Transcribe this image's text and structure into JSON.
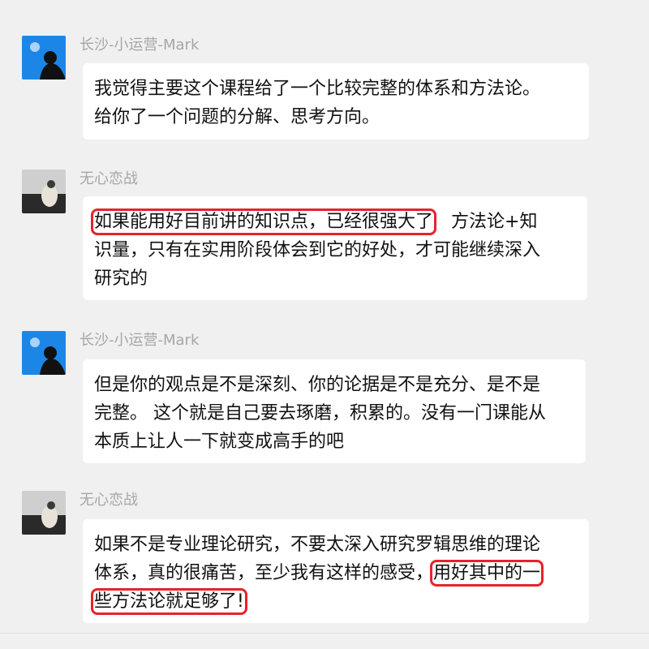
{
  "chat": {
    "messages": [
      {
        "sender": "长沙-小运营-Mark",
        "avatar_icon": "blue-silhouette-avatar-icon",
        "lines": [
          "我觉得主要这个课程给了一个比较完整的体系和方法论。",
          "给你了一个问题的分解、思考方向。"
        ]
      },
      {
        "sender": "无心恋战",
        "avatar_icon": "dark-photo-avatar-icon",
        "highlight": "如果能用好目前讲的知识点，已经很强大了",
        "line1_rest": "方法论+知",
        "lines": [
          "识量，只有在实用阶段体会到它的好处，才可能继续深入",
          "研究的"
        ]
      },
      {
        "sender": "长沙-小运营-Mark",
        "avatar_icon": "blue-silhouette-avatar-icon",
        "lines": [
          "但是你的观点是不是深刻、你的论据是不是充分、是不是",
          "完整。 这个就是自己要去琢磨，积累的。没有一门课能从",
          "本质上让人一下就变成高手的吧"
        ]
      },
      {
        "sender": "无心恋战",
        "avatar_icon": "dark-photo-avatar-icon",
        "line1": "如果不是专业理论研究，不要太深入研究罗辑思维的理论",
        "line2_plain": "体系，真的很痛苦，至少我有这样的感受，",
        "highlight_a": "用好其中的一",
        "highlight_b": "些方法论就足够了!"
      }
    ]
  },
  "colors": {
    "background": "#f0f0f0",
    "bubble": "#ffffff",
    "sender_name": "#a6a6a6",
    "highlight_box": "#e8222b"
  }
}
